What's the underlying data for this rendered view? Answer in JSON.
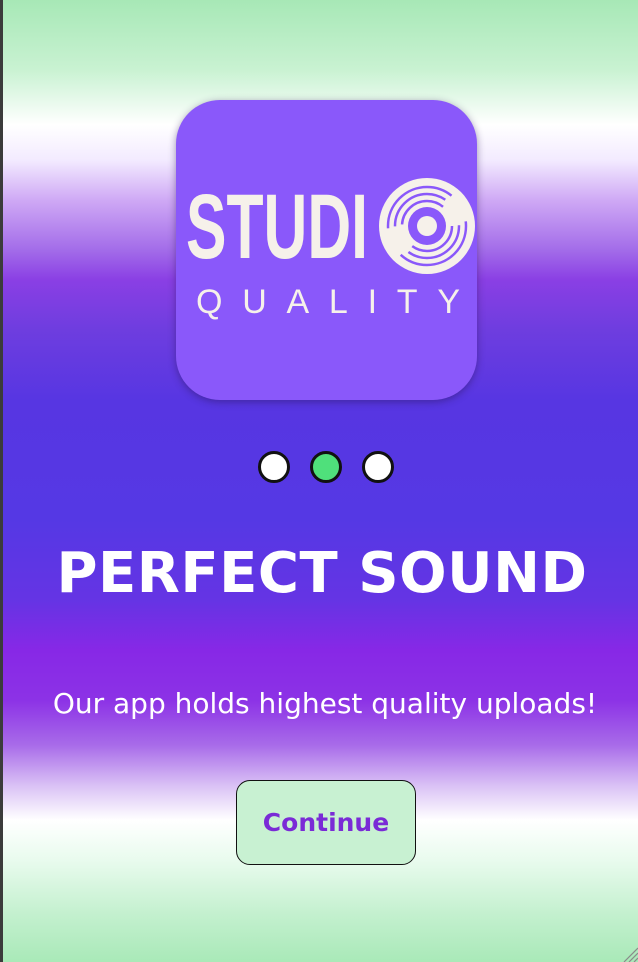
{
  "logo": {
    "word_top": "STUDI",
    "word_bottom": "QUALITY",
    "icon": "vinyl-disc-icon",
    "card_color": "#8a58fa"
  },
  "pagination": {
    "total": 3,
    "active_index": 1,
    "active_color": "#4fe07b"
  },
  "title": "PERFECT SOUND",
  "subtitle": "Our app holds highest quality uploads!",
  "continue_button": {
    "label": "Continue"
  }
}
